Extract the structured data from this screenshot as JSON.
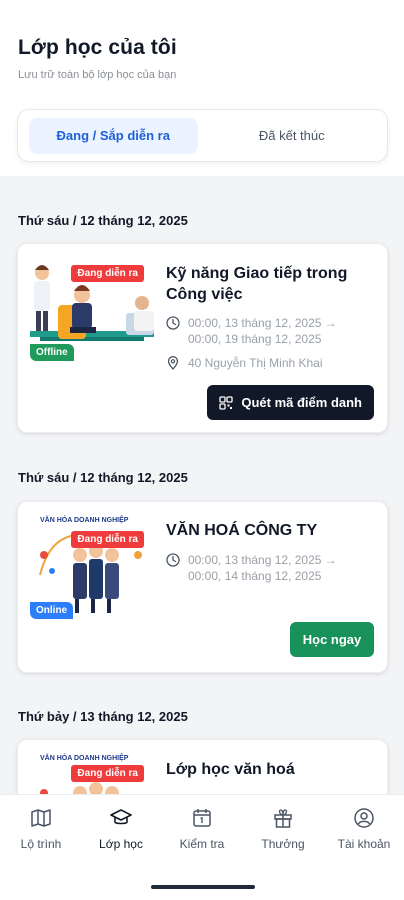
{
  "header": {
    "title": "Lớp học của tôi",
    "subtitle": "Lưu trữ toàn bộ lớp học của bạn"
  },
  "tabs": [
    {
      "label": "Đang / Sắp diễn ra",
      "active": true
    },
    {
      "label": "Đã kết thúc",
      "active": false
    }
  ],
  "sections": [
    {
      "date": "Thứ sáu / 12 tháng 12, 2025",
      "course": {
        "title": "Kỹ năng Giao tiếp trong Công việc",
        "status_badge": "Đang diễn ra",
        "mode_badge": "Offline",
        "time": "00:00, 13 tháng 12, 2025 → 00:00, 19 tháng 12, 2025",
        "location": "40 Nguyễn Thị Minh Khai",
        "action_label": "Quét mã điểm danh"
      }
    },
    {
      "date": "Thứ sáu / 12 tháng 12, 2025",
      "course": {
        "title": "VĂN HOÁ CÔNG TY",
        "status_badge": "Đang diễn ra",
        "mode_badge": "Online",
        "thumb_caption": "VĂN HÓA DOANH NGHIỆP",
        "time": "00:00, 13 tháng 12, 2025 → 00:00, 14 tháng 12, 2025",
        "action_label": "Học ngay"
      }
    },
    {
      "date": "Thứ bảy / 13 tháng 12, 2025",
      "course": {
        "title": "Lớp học văn hoá",
        "status_badge": "Đang diễn ra",
        "thumb_caption": "VĂN HÓA DOANH NGHIỆP"
      }
    }
  ],
  "bottom_nav": [
    {
      "label": "Lộ trình",
      "icon": "map-icon"
    },
    {
      "label": "Lớp học",
      "icon": "graduation-cap-icon",
      "active": true
    },
    {
      "label": "Kiểm tra",
      "icon": "calendar-check-icon"
    },
    {
      "label": "Thưởng",
      "icon": "gift-icon"
    },
    {
      "label": "Tài khoản",
      "icon": "user-circle-icon"
    }
  ],
  "colors": {
    "accent_blue": "#1e60d8",
    "tab_active_bg": "#eaf3ff",
    "live_red": "#ef3b3b",
    "offline_green": "#1f9a5b",
    "online_blue": "#2d7ff9",
    "primary_dark": "#111827",
    "cta_green": "#18915a"
  }
}
